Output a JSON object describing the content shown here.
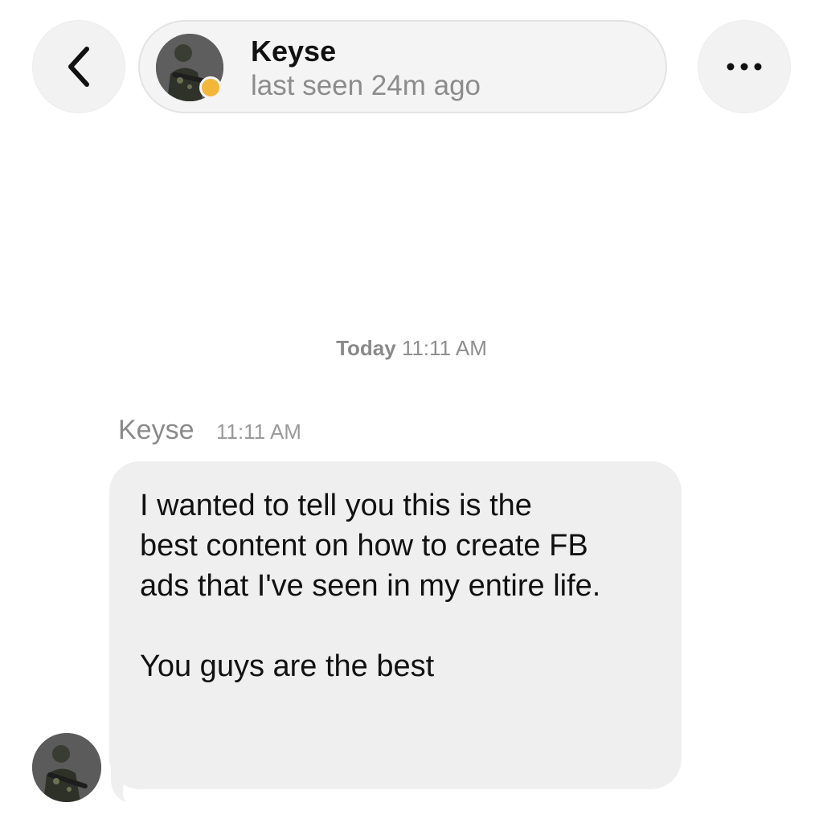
{
  "header": {
    "contact_name": "Keyse",
    "status": "last seen 24m ago",
    "presence_color": "#f2b73a"
  },
  "icons": {
    "back": "chevron-left-icon",
    "more": "ellipsis-icon"
  },
  "conversation": {
    "date_separator": {
      "day": "Today",
      "time": "11:11 AM"
    },
    "messages": [
      {
        "sender": "Keyse",
        "time": "11:11 AM",
        "lines": [
          "I wanted to tell you this is the",
          "best content on how to create FB",
          "ads that I've seen in my entire life.",
          "",
          "You guys are the best"
        ]
      }
    ]
  }
}
